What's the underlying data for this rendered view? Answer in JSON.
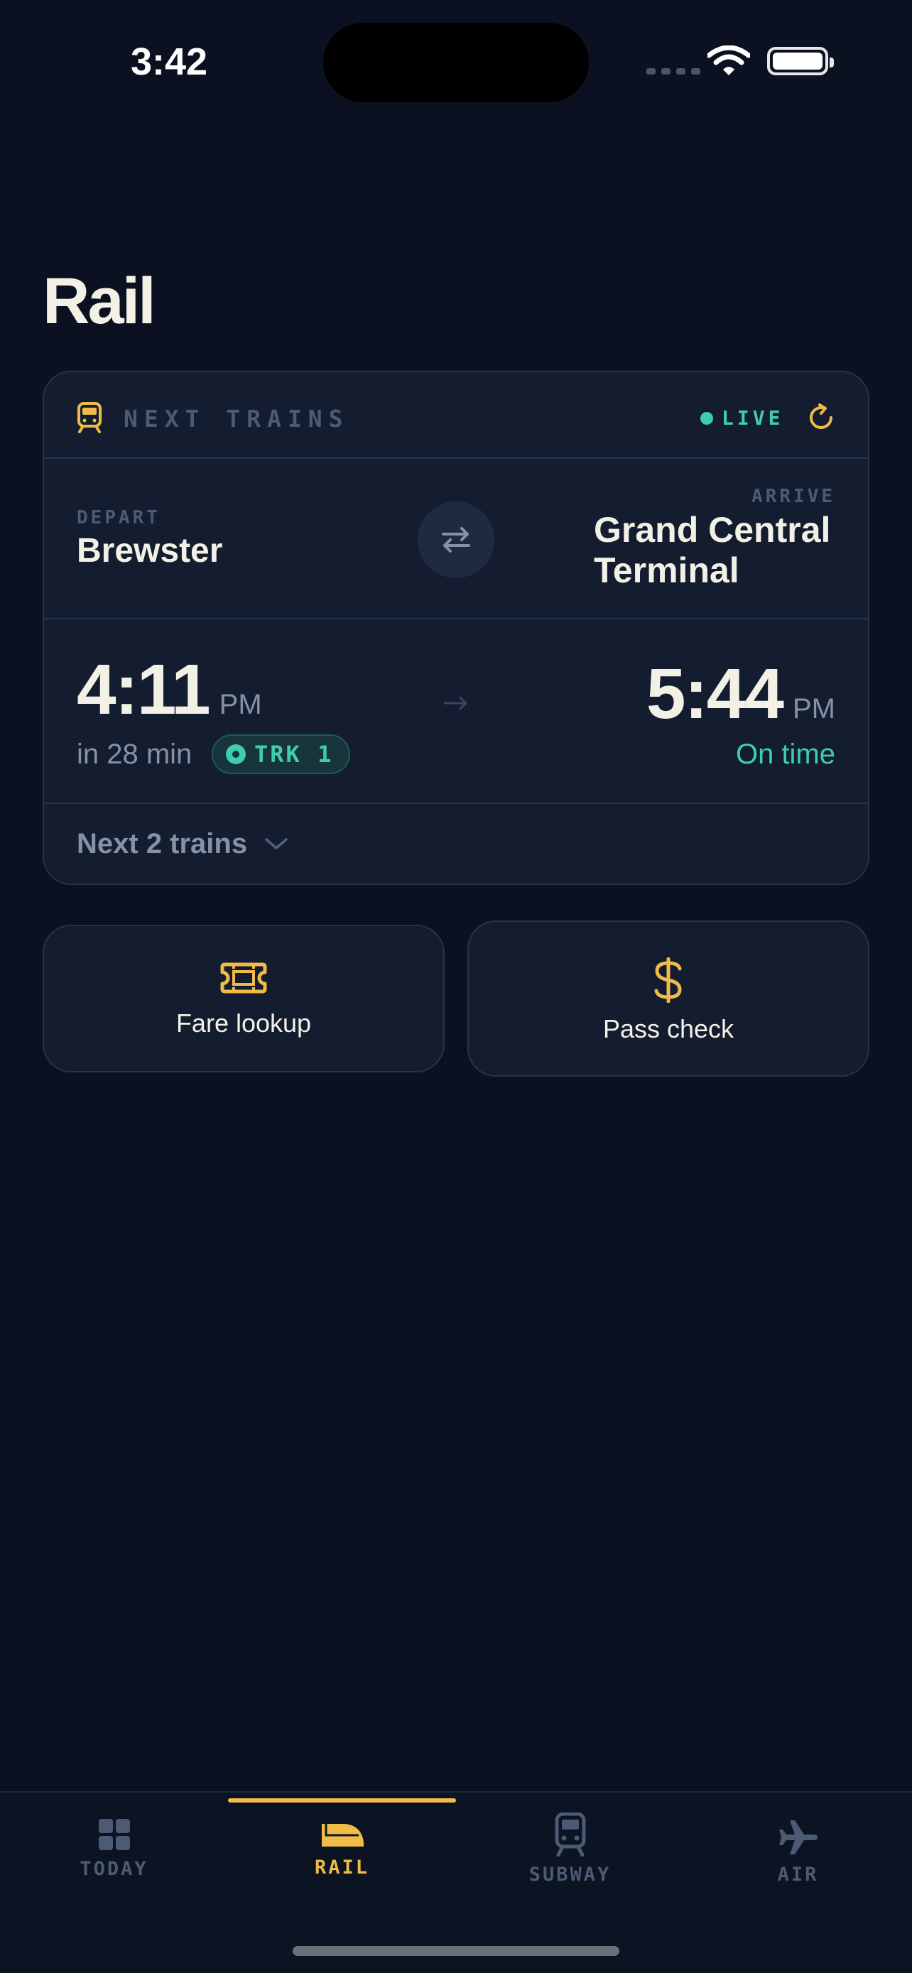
{
  "status_bar": {
    "time": "3:42"
  },
  "page": {
    "title": "Rail"
  },
  "next_trains": {
    "heading": "NEXT TRAINS",
    "live_label": "LIVE",
    "depart": {
      "label": "DEPART",
      "station": "Brewster"
    },
    "arrive": {
      "label": "ARRIVE",
      "station": "Grand Central Terminal"
    },
    "departure_time": "4:11",
    "departure_ampm": "PM",
    "eta": "in 28 min",
    "track": "TRK 1",
    "arrival_time": "5:44",
    "arrival_ampm": "PM",
    "status": "On time",
    "next_label": "Next 2 trains"
  },
  "actions": [
    {
      "label": "Fare lookup",
      "icon": "ticket-icon"
    },
    {
      "label": "Pass check",
      "icon": "dollar-icon"
    }
  ],
  "tabs": [
    {
      "label": "TODAY",
      "icon": "grid-icon",
      "active": false
    },
    {
      "label": "RAIL",
      "icon": "rail-icon",
      "active": true
    },
    {
      "label": "SUBWAY",
      "icon": "subway-icon",
      "active": false
    },
    {
      "label": "AIR",
      "icon": "plane-icon",
      "active": false
    }
  ],
  "colors": {
    "background": "#0b1120",
    "card": "#131d2f",
    "accent": "#f0bb47",
    "live": "#3fcdb2",
    "muted": "#8791a6"
  }
}
